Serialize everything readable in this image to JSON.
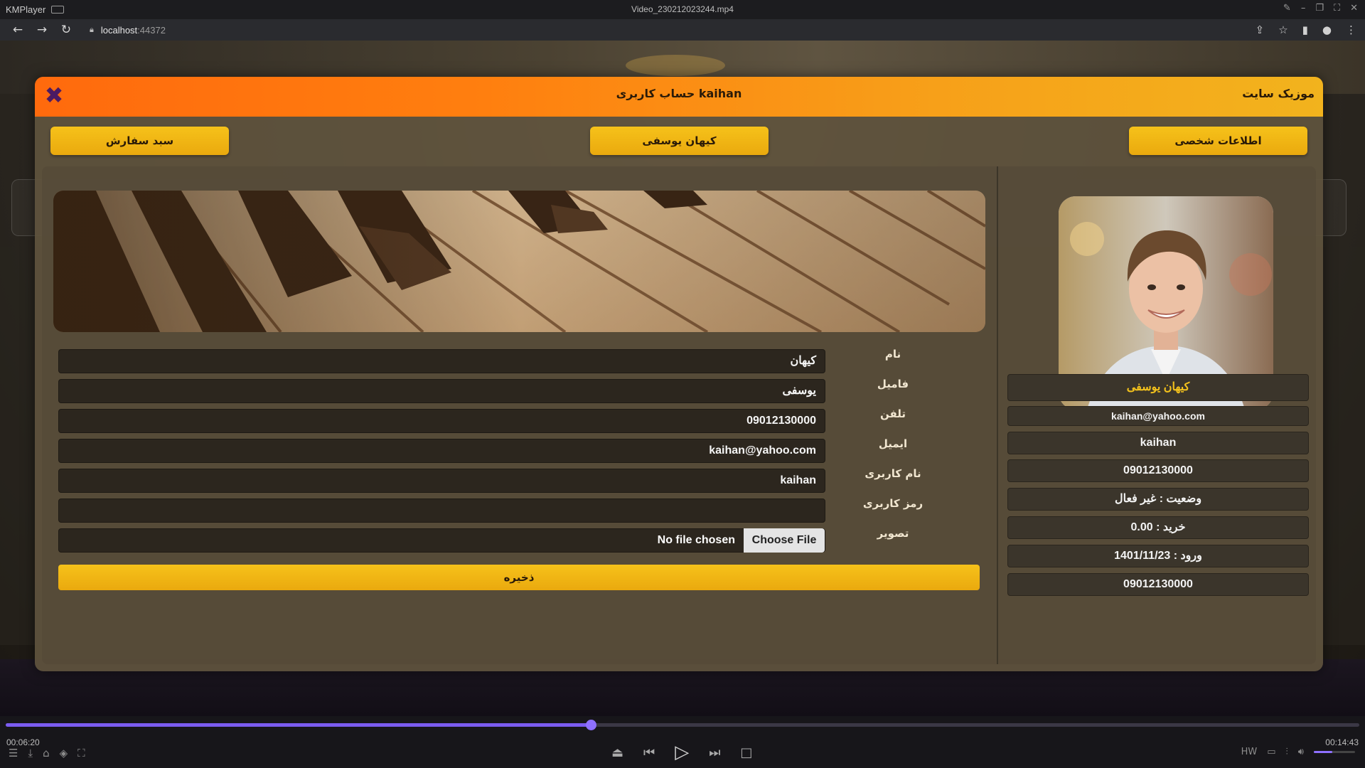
{
  "player": {
    "app_name": "KMPlayer",
    "file_name": "Video_230212023244.mp4",
    "time_current": "00:06:20",
    "time_total": "00:14:43",
    "progress": 0.432,
    "volume": 0.45,
    "accent_color": "#7b5cf0"
  },
  "browser": {
    "url_host": "localhost",
    "url_port": ":44372"
  },
  "modal": {
    "title": "حساب کاربری kaihan",
    "site_name": "موزیک سایت",
    "close_glyph": "✖",
    "header_colors": [
      "#ff6a0d",
      "#f2b31d"
    ]
  },
  "tabs": {
    "personal_info": "اطلاعات شخصی",
    "user_name": "کیهان یوسفی",
    "order_basket": "سبد سفارش"
  },
  "form": {
    "fields": [
      {
        "label": "نام",
        "value": "کیهان"
      },
      {
        "label": "فامیل",
        "value": "یوسفی"
      },
      {
        "label": "تلفن",
        "value": "09012130000"
      },
      {
        "label": "ایمیل",
        "value": "kaihan@yahoo.com"
      },
      {
        "label": "نام کاربری",
        "value": "kaihan"
      },
      {
        "label": "رمز کاربری",
        "value": ""
      }
    ],
    "image_label": "تصویر",
    "file_button": "Choose File",
    "file_status": "No file chosen",
    "save_label": "ذخیره"
  },
  "profile": {
    "full_name": "کیهان یوسفی",
    "email": "kaihan@yahoo.com",
    "username": "kaihan",
    "phone": "09012130000",
    "status": "وضعیت : غیر فعال",
    "purchase": "خرید : 0.00",
    "login": "ورود : 1401/11/23",
    "phone2": "09012130000"
  }
}
